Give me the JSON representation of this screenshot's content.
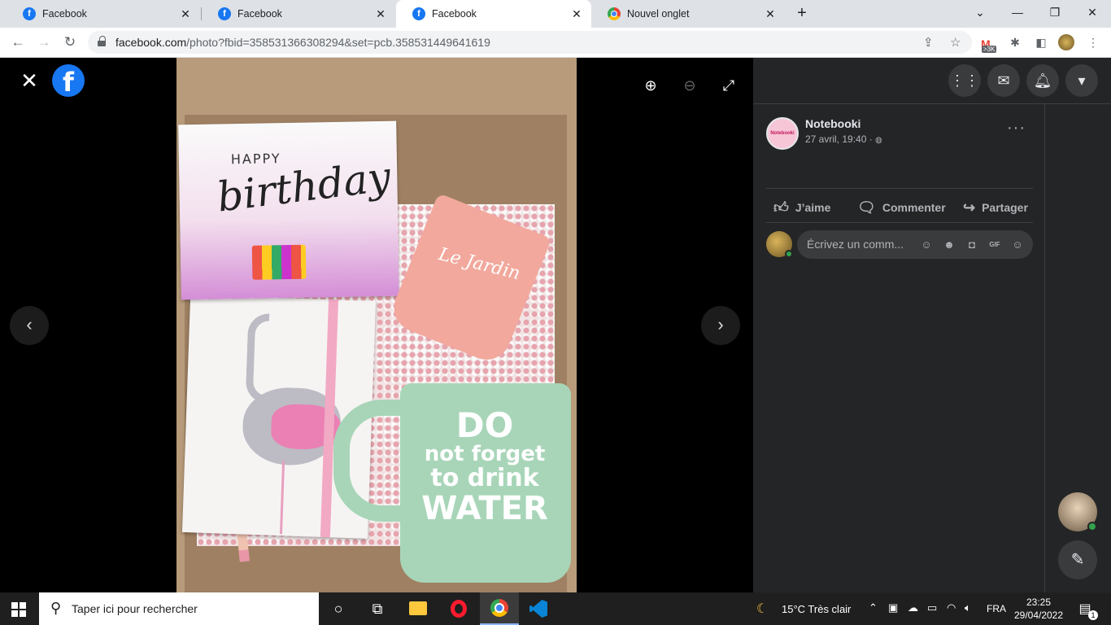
{
  "browser": {
    "tabs": [
      {
        "title": "Facebook",
        "favicon": "facebook-icon",
        "active": false
      },
      {
        "title": "Facebook",
        "favicon": "facebook-icon",
        "active": false
      },
      {
        "title": "Facebook",
        "favicon": "facebook-icon",
        "active": true
      },
      {
        "title": "Nouvel onglet",
        "favicon": "chrome-icon",
        "active": false
      }
    ],
    "new_tab_icon": "+",
    "window_controls": {
      "minimize": "—",
      "maximize": "❐",
      "close": "✕",
      "tab_list": "⌄"
    },
    "nav": {
      "back": "←",
      "forward": "→",
      "reload": "↻"
    },
    "url": {
      "host": "facebook.com",
      "path": "/photo?fbid=358531366308294&set=pcb.358531449641619"
    },
    "gmail_badge": ">3K"
  },
  "viewer": {
    "close_icon": "✕",
    "logo_letter": "f",
    "zoom_in_icon": "⊕",
    "zoom_out_icon": "⊖",
    "fullscreen_icon": "⤢",
    "prev_icon": "‹",
    "next_icon": "›",
    "photo_text": {
      "card_happy": "HAPPY",
      "card_birthday": "birthday",
      "glass_text": "Le Jardin",
      "mug_line1": "DO",
      "mug_line2": "not forget",
      "mug_line3": "to drink",
      "mug_line4": "WATER"
    }
  },
  "panel": {
    "page_name": "Notebooki",
    "page_avatar_text": "Notebooki",
    "post_date": "27 avril, 19:40 · ",
    "globe_icon": "🌐",
    "more_icon": "···",
    "actions": {
      "like": "J’aime",
      "comment": "Commenter",
      "share": "Partager"
    },
    "comment_placeholder": "Écrivez un comm..."
  },
  "taskbar": {
    "search_placeholder": "Taper ici pour rechercher",
    "weather": "15°C  Très clair",
    "language": "FRA",
    "time": "23:25",
    "date": "29/04/2022",
    "notification_count": "1"
  },
  "colors": {
    "facebook_blue": "#1877f2",
    "panel_bg": "#242526",
    "online_green": "#31a24c"
  }
}
